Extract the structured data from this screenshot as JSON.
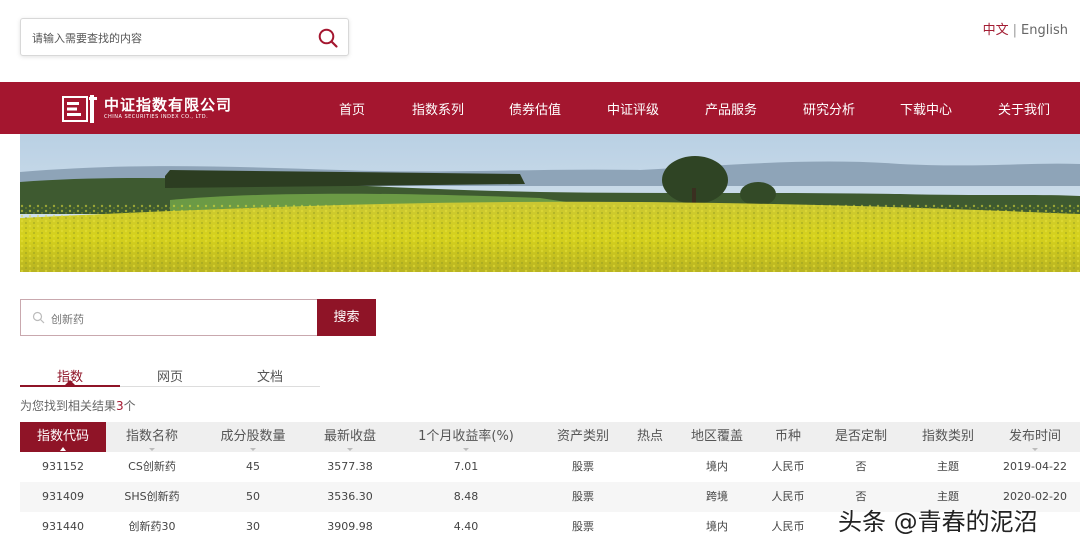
{
  "top_search": {
    "placeholder": "请输入需要查找的内容"
  },
  "language": {
    "chinese": "中文",
    "separator": "|",
    "english": "English"
  },
  "brand": {
    "name_cn": "中证指数有限公司",
    "name_en": "CHINA SECURITIES INDEX CO., LTD."
  },
  "nav": [
    "首页",
    "指数系列",
    "债券估值",
    "中证评级",
    "产品服务",
    "研究分析",
    "下载中心",
    "关于我们"
  ],
  "search2": {
    "value": "创新药",
    "button": "搜索"
  },
  "tabs": [
    "指数",
    "网页",
    "文档"
  ],
  "result": {
    "prefix": "为您找到相关结果",
    "count": "3",
    "suffix": "个"
  },
  "table": {
    "headers": [
      "指数代码",
      "指数名称",
      "成分股数量",
      "最新收盘",
      "1个月收益率(%)",
      "资产类别",
      "热点",
      "地区覆盖",
      "币种",
      "是否定制",
      "指数类别",
      "发布时间"
    ],
    "rows": [
      [
        "931152",
        "CS创新药",
        "45",
        "3577.38",
        "7.01",
        "股票",
        "",
        "境内",
        "人民币",
        "否",
        "主题",
        "2019-04-22"
      ],
      [
        "931409",
        "SHS创新药",
        "50",
        "3536.30",
        "8.48",
        "股票",
        "",
        "跨境",
        "人民币",
        "否",
        "主题",
        "2020-02-20"
      ],
      [
        "931440",
        "创新药30",
        "30",
        "3909.98",
        "4.40",
        "股票",
        "",
        "境内",
        "人民币",
        "",
        "",
        ""
      ]
    ]
  },
  "watermark": "头条 @青春的泥沼",
  "colors": {
    "brand": "#a4162f",
    "dark_brand": "#8f1427"
  }
}
